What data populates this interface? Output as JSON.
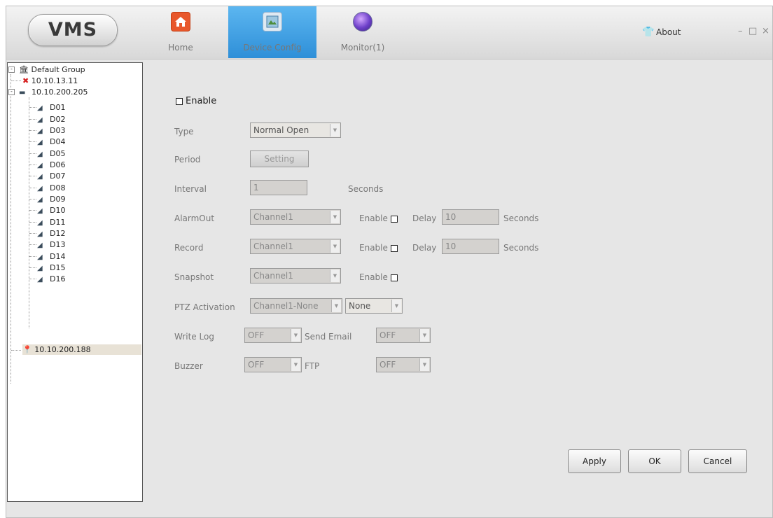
{
  "app": {
    "logo": "VMS"
  },
  "nav": {
    "tabs": [
      {
        "label": "Home",
        "icon": "home-icon"
      },
      {
        "label": "Device Config",
        "icon": "device-config-icon",
        "active": true
      },
      {
        "label": "Monitor(1)",
        "icon": "monitor-icon"
      }
    ],
    "about": "About",
    "minimize": "–",
    "maximize": "□",
    "close": "×"
  },
  "tree": {
    "group": "Default Group",
    "devices": [
      {
        "label": "10.10.13.11",
        "status": "offline"
      },
      {
        "label": "10.10.200.205",
        "status": "online",
        "channels": [
          "D01",
          "D02",
          "D03",
          "D04",
          "D05",
          "D06",
          "D07",
          "D08",
          "D09",
          "D10",
          "D11",
          "D12",
          "D13",
          "D14",
          "D15",
          "D16"
        ]
      },
      {
        "label": "10.10.200.188",
        "status": "selected"
      }
    ]
  },
  "form": {
    "enable": "Enable",
    "type": {
      "label": "Type",
      "value": "Normal Open"
    },
    "period": {
      "label": "Period",
      "button": "Setting"
    },
    "interval": {
      "label": "Interval",
      "value": "1",
      "unit": "Seconds"
    },
    "alarmout": {
      "label": "AlarmOut",
      "value": "Channel1",
      "enable": "Enable",
      "delay": "Delay",
      "delay_value": "10",
      "unit": "Seconds"
    },
    "record": {
      "label": "Record",
      "value": "Channel1",
      "enable": "Enable",
      "delay": "Delay",
      "delay_value": "10",
      "unit": "Seconds"
    },
    "snapshot": {
      "label": "Snapshot",
      "value": "Channel1",
      "enable": "Enable"
    },
    "ptz": {
      "label": "PTZ Activation",
      "value": "Channel1-None",
      "value2": "None"
    },
    "writelog": {
      "label": "Write Log",
      "value": "OFF"
    },
    "sendemail": {
      "label": "Send Email",
      "value": "OFF"
    },
    "buzzer": {
      "label": "Buzzer",
      "value": "OFF"
    },
    "ftp": {
      "label": "FTP",
      "value": "OFF"
    }
  },
  "buttons": {
    "apply": "Apply",
    "ok": "OK",
    "cancel": "Cancel"
  }
}
